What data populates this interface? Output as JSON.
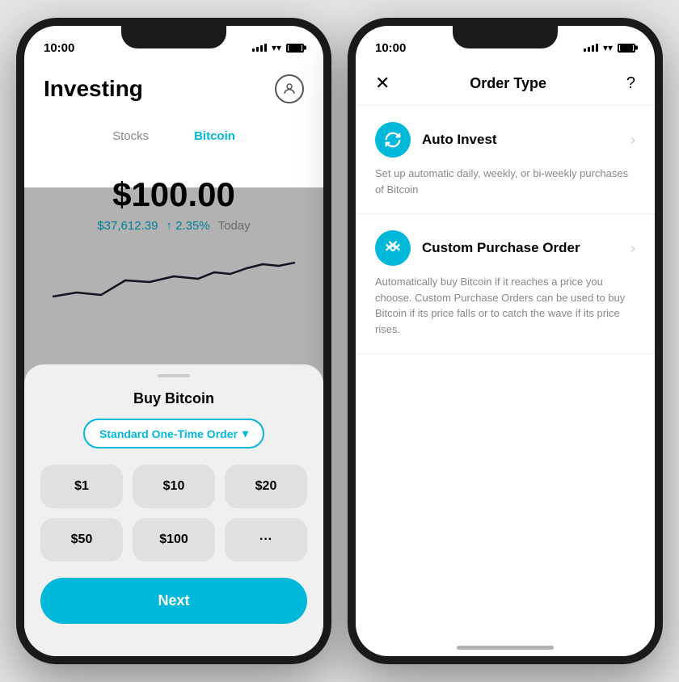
{
  "leftPhone": {
    "statusBar": {
      "time": "10:00",
      "signal": true,
      "wifi": true,
      "battery": true
    },
    "header": {
      "title": "Investing",
      "profileIcon": "👤"
    },
    "tabs": [
      {
        "label": "Stocks",
        "active": false
      },
      {
        "label": "Bitcoin",
        "active": true
      }
    ],
    "portfolio": {
      "value": "$100.00",
      "btcPrice": "$37,612.39",
      "change": "↑ 2.35%",
      "period": "Today"
    },
    "bottomSheet": {
      "title": "Buy Bitcoin",
      "orderTypeLabel": "Standard One-Time Order",
      "orderTypeArrow": "▾",
      "amounts": [
        "$1",
        "$10",
        "$20",
        "$50",
        "$100",
        "···"
      ],
      "nextButton": "Next"
    }
  },
  "rightPhone": {
    "statusBar": {
      "time": "10:00",
      "signal": true,
      "wifi": true,
      "battery": true
    },
    "header": {
      "closeLabel": "✕",
      "title": "Order Type",
      "helpLabel": "?"
    },
    "options": [
      {
        "name": "Auto Invest",
        "iconSymbol": "↺",
        "description": "Set up automatic daily, weekly, or bi-weekly purchases of Bitcoin"
      },
      {
        "name": "Custom Purchase Order",
        "iconSymbol": "↗",
        "description": "Automatically buy Bitcoin if it reaches a price you choose. Custom Purchase Orders can be used to buy Bitcoin if its price falls or to catch the wave if its price rises."
      }
    ]
  }
}
